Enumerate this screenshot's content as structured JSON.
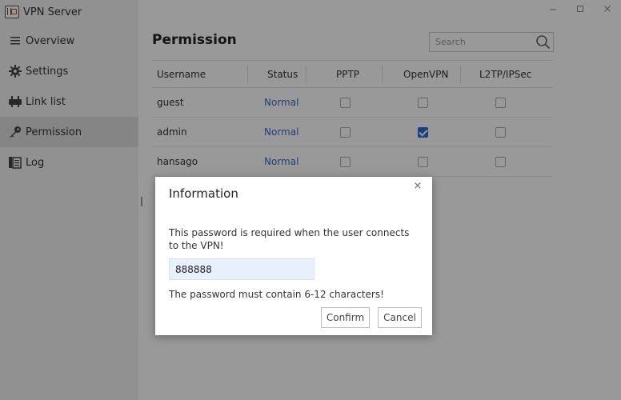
{
  "app": {
    "title": "VPN Server",
    "window_controls": [
      "minimize",
      "maximize",
      "close"
    ]
  },
  "sidebar": {
    "items": [
      {
        "label": "Overview",
        "icon": "menu-icon",
        "active": false
      },
      {
        "label": "Settings",
        "icon": "gear-icon",
        "active": false
      },
      {
        "label": "Link list",
        "icon": "link-list-icon",
        "active": false
      },
      {
        "label": "Permission",
        "icon": "key-icon",
        "active": true
      },
      {
        "label": "Log",
        "icon": "log-icon",
        "active": false
      }
    ]
  },
  "main": {
    "title": "Permission",
    "search": {
      "placeholder": "Search",
      "value": ""
    },
    "table": {
      "columns": [
        "Username",
        "Status",
        "PPTP",
        "OpenVPN",
        "L2TP/IPSec"
      ],
      "rows": [
        {
          "username": "guest",
          "status": "Normal",
          "pptp": false,
          "openvpn": false,
          "l2tp": false
        },
        {
          "username": "admin",
          "status": "Normal",
          "pptp": false,
          "openvpn": true,
          "l2tp": false
        },
        {
          "username": "hansago",
          "status": "Normal",
          "pptp": false,
          "openvpn": false,
          "l2tp": false
        }
      ]
    }
  },
  "dialog": {
    "title": "Information",
    "close_label": "×",
    "message": "This password is required when the user connects to the VPN!",
    "password_value": "888888",
    "hint": "The password must contain 6-12 characters!",
    "confirm_label": "Confirm",
    "cancel_label": "Cancel"
  },
  "colors": {
    "accent": "#2f6bd4",
    "status_link": "#3a6cc4",
    "sidebar_bg": "#f2f2f2",
    "sidebar_active": "#dedede"
  }
}
